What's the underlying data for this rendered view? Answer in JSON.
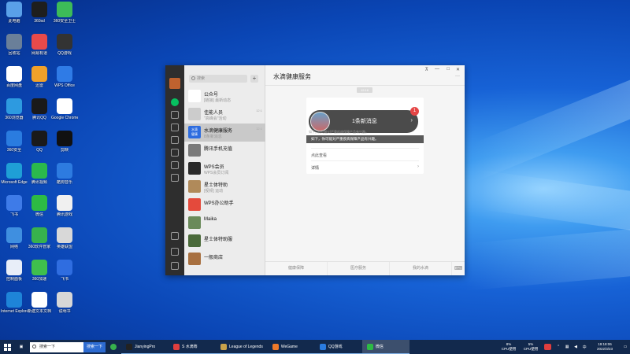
{
  "desktop": {
    "icons": [
      {
        "label": "此电脑",
        "color": "#5aa0e8",
        "icon": "computer-icon"
      },
      {
        "label": "360sd",
        "color": "#1e1e1e",
        "icon": "app-icon"
      },
      {
        "label": "360安全卫士",
        "color": "#3dbb58",
        "icon": "shield-icon"
      },
      {
        "label": "回收站",
        "color": "#6a7f99",
        "icon": "recycle-bin-icon"
      },
      {
        "label": "网易有道",
        "color": "#e84a4a",
        "icon": "app-icon"
      },
      {
        "label": "QQ游戏",
        "color": "#333333",
        "icon": "game-icon"
      },
      {
        "label": "百度网盘",
        "color": "#ffffff",
        "icon": "app-icon"
      },
      {
        "label": "迅雷",
        "color": "#f0a12a",
        "icon": "app-icon"
      },
      {
        "label": "WPS Office",
        "color": "#2f7be6",
        "icon": "wps-icon"
      },
      {
        "label": "360浏览器",
        "color": "#2d9ae0",
        "icon": "browser-icon"
      },
      {
        "label": "腾讯QQ",
        "color": "#1a1a1a",
        "icon": "qq-icon"
      },
      {
        "label": "Google Chrome",
        "color": "#ffffff",
        "icon": "chrome-icon"
      },
      {
        "label": "360安全",
        "color": "#2a7ce0",
        "icon": "app-icon"
      },
      {
        "label": "QQ",
        "color": "#1a1a1a",
        "icon": "qq-icon"
      },
      {
        "label": "剪映",
        "color": "#111111",
        "icon": "capcut-icon"
      },
      {
        "label": "Microsoft Edge",
        "color": "#1f9fd6",
        "icon": "edge-icon"
      },
      {
        "label": "腾讯视频",
        "color": "#2bb94c",
        "icon": "video-icon"
      },
      {
        "label": "酷狗音乐",
        "color": "#2d7be0",
        "icon": "music-icon"
      },
      {
        "label": "飞书",
        "color": "#3e7be8",
        "icon": "app-icon"
      },
      {
        "label": "微信",
        "color": "#2dbb44",
        "icon": "wechat-icon"
      },
      {
        "label": "腾讯游戏",
        "color": "#f0f0f0",
        "icon": "app-icon"
      },
      {
        "label": "网络",
        "color": "#3f8fe0",
        "icon": "network-icon"
      },
      {
        "label": "360软件管家",
        "color": "#37b24d",
        "icon": "app-icon"
      },
      {
        "label": "英雄联盟",
        "color": "#d8d8d8",
        "icon": "app-icon"
      },
      {
        "label": "控制面板",
        "color": "#e8eef8",
        "icon": "control-panel-icon"
      },
      {
        "label": "360加速",
        "color": "#3fbf4d",
        "icon": "app-icon"
      },
      {
        "label": "飞书",
        "color": "#2f6de0",
        "icon": "app-icon"
      },
      {
        "label": "Internet Explorer",
        "color": "#1e84d8",
        "icon": "ie-icon"
      },
      {
        "label": "新建文本文档",
        "color": "#ffffff",
        "icon": "document-icon"
      },
      {
        "label": "说明书",
        "color": "#d7d7d7",
        "icon": "document-icon"
      }
    ]
  },
  "wechat": {
    "search_placeholder": "搜索",
    "add_label": "+",
    "chats": [
      {
        "title": "公众号",
        "sub": "[链接] 最新动态",
        "time": "",
        "color": "#ffffff"
      },
      {
        "title": "佳能人员",
        "sub": "\"高峰会\"活动",
        "time": "12:1",
        "color": "#cccccc"
      },
      {
        "title": "水滴健康服务",
        "sub": "8条新消息",
        "time": "12:1",
        "color": "#2d6cdf",
        "avatarText": "水滴\n健康"
      },
      {
        "title": "腾讯手机充值",
        "sub": "",
        "time": "",
        "color": "#7a7a7a"
      },
      {
        "title": "WPS会员",
        "sub": "WPS会员订阅",
        "time": "",
        "color": "#2a2a2a"
      },
      {
        "title": "星士体特助",
        "sub": "[视频] 运动",
        "time": "",
        "color": "#b08a5a"
      },
      {
        "title": "WPS办公助手",
        "sub": "",
        "time": "",
        "color": "#e44a3c"
      },
      {
        "title": "Maika",
        "sub": "",
        "time": "",
        "color": "#6a8a5a"
      },
      {
        "title": "星士体特助服",
        "sub": "",
        "time": "",
        "color": "#4a6a3a"
      },
      {
        "title": "一般商店",
        "sub": "",
        "time": "",
        "color": "#a87040"
      }
    ],
    "title": "水滴健康服务",
    "window_controls": {
      "pin": "⊼",
      "min": "—",
      "max": "□",
      "close": "✕",
      "more": "···"
    },
    "timestamp": "12:16",
    "notify_text": "1条新消息",
    "badge": "1",
    "hint1": "如下，你可能对严重疾病保障产品有兴趣。",
    "hint2": "如下，你可能对严重疾病保障产品有兴趣。",
    "view_more": "点此查看",
    "details": "详情",
    "bottom_tabs": [
      "健康保障",
      "医疗服务",
      "我的水滴"
    ]
  },
  "taskbar": {
    "search_placeholder": "搜索一下",
    "search_button": "搜索一下",
    "apps": [
      {
        "label": "JianyingPro",
        "color": "#222222",
        "active": false
      },
      {
        "label": "S 水滴筹",
        "color": "#e03e3e",
        "active": false
      },
      {
        "label": "League of Legends",
        "color": "#c9a24a",
        "active": false
      },
      {
        "label": "WeGame",
        "color": "#f07a2a",
        "active": false
      },
      {
        "label": "QQ游戏",
        "color": "#2a7be0",
        "active": false
      },
      {
        "label": "微信",
        "color": "#2dbb44",
        "active": true
      }
    ],
    "cpu1_value": "8%",
    "cpu1_label": "CPU使用",
    "cpu2_value": "5%",
    "cpu2_label": "CPU使用",
    "time": "19:18:06",
    "date": "2022/3/23"
  }
}
